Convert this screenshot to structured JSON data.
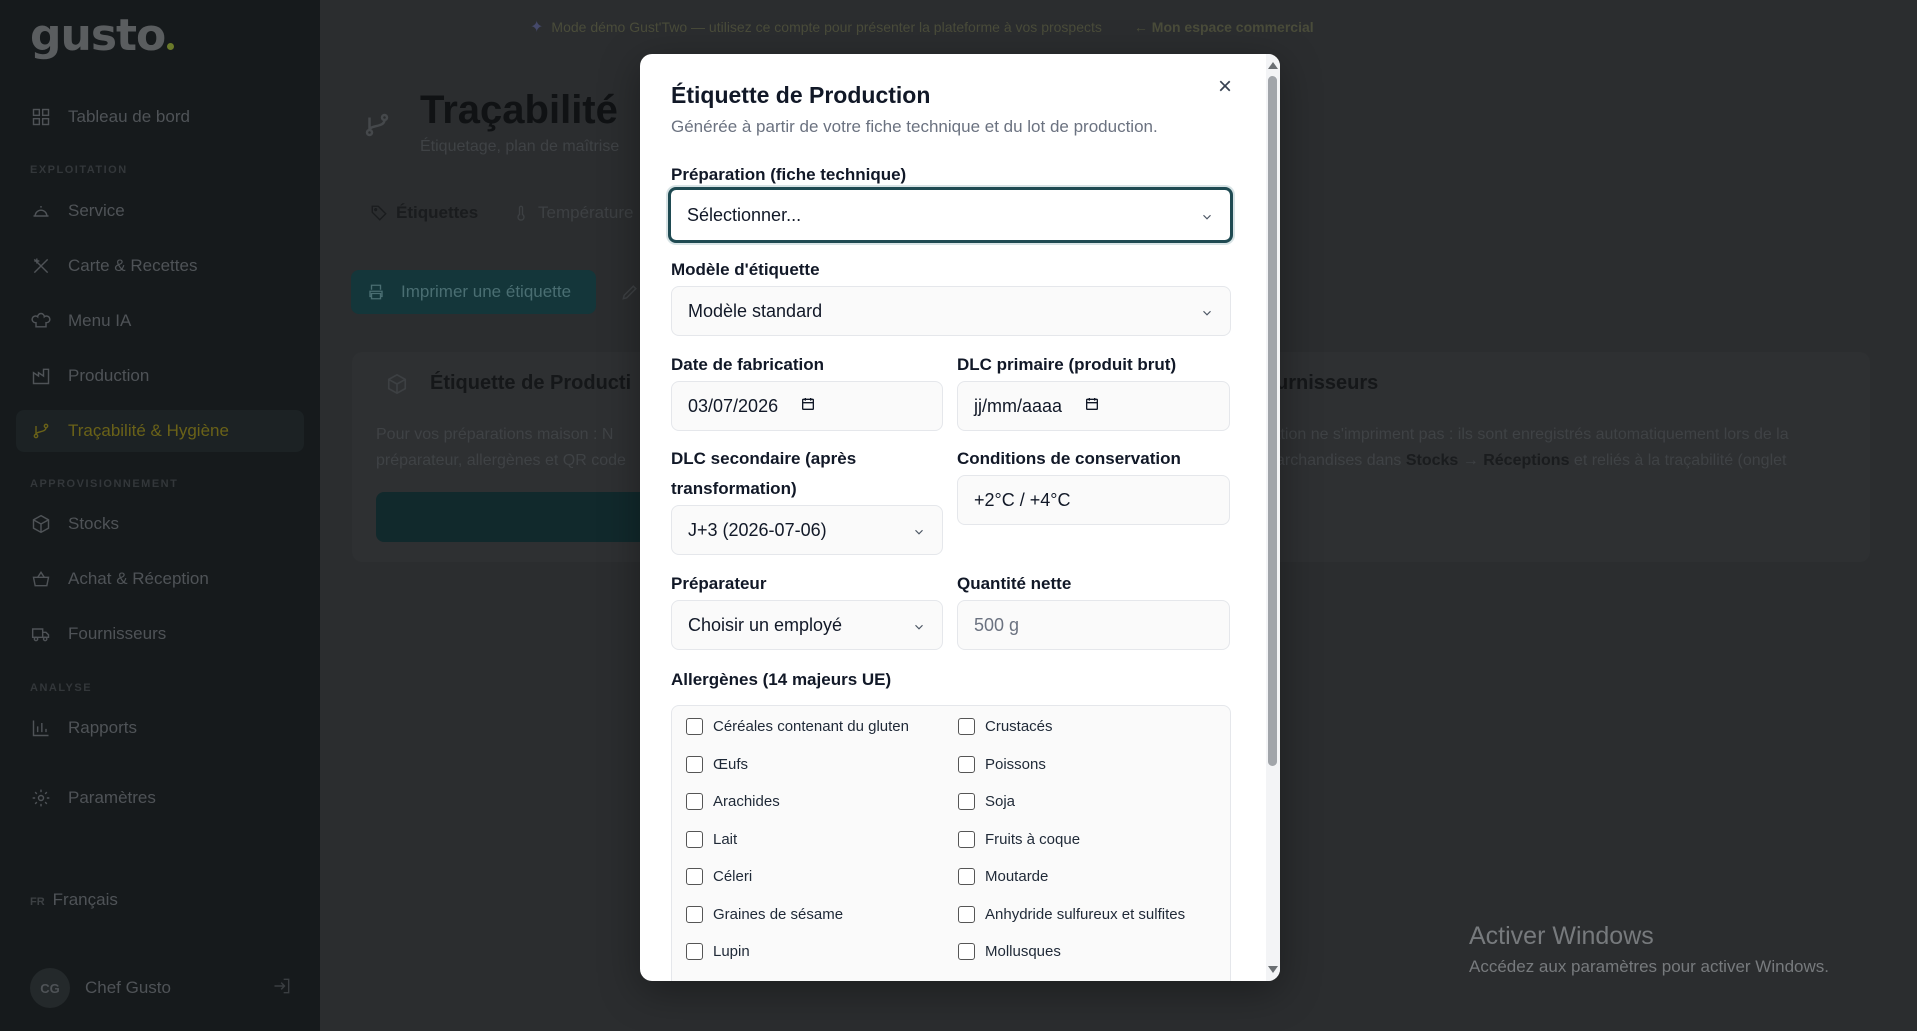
{
  "sidebar": {
    "logo": "gusto",
    "items": [
      {
        "label": "Tableau de bord",
        "icon": "dashboard-icon"
      },
      {
        "label": "Service",
        "icon": "service-icon"
      },
      {
        "label": "Carte & Recettes",
        "icon": "utensils-icon"
      },
      {
        "label": "Menu IA",
        "icon": "chef-hat-icon"
      },
      {
        "label": "Production",
        "icon": "factory-icon"
      },
      {
        "label": "Traçabilité & Hygiène",
        "icon": "branch-icon"
      },
      {
        "label": "Stocks",
        "icon": "box-icon"
      },
      {
        "label": "Achat & Réception",
        "icon": "basket-icon"
      },
      {
        "label": "Fournisseurs",
        "icon": "truck-icon"
      },
      {
        "label": "Rapports",
        "icon": "chart-icon"
      },
      {
        "label": "Paramètres",
        "icon": "gear-icon"
      }
    ],
    "sections": {
      "exploitation": "EXPLOITATION",
      "approvisionnement": "APPROVISIONNEMENT",
      "analyse": "ANALYSE"
    },
    "language": {
      "code": "FR",
      "label": "Français"
    },
    "user": {
      "initials": "CG",
      "name": "Chef Gusto"
    }
  },
  "topbar": {
    "demo_text": "Mode démo Gust'Two — utilisez ce compte pour présenter la plateforme à vos prospects",
    "back_text": "← Mon espace commercial"
  },
  "page": {
    "title": "Traçabilité",
    "subtitle": "Étiquetage, plan de maîtrise",
    "tabs": [
      {
        "label": "Étiquettes"
      },
      {
        "label": "Température"
      }
    ],
    "print_button": "Imprimer une étiquette",
    "card_left": {
      "title": "Étiquette de Producti",
      "text1": "Pour vos préparations maison : N",
      "text2": "préparateur, allergènes et QR code"
    },
    "card_right": {
      "title": "urnisseurs",
      "text1": "ttion ne s'impriment pas : ils sont enregistrés automatiquement lors de la",
      "text2_pre": "archandises dans ",
      "text2_b1": "Stocks",
      "text2_mid": " → ",
      "text2_b2": "Réceptions",
      "text2_post": " et reliés à la traçabilité (onglet"
    }
  },
  "modal": {
    "title": "Étiquette de Production",
    "subtitle": "Générée à partir de votre fiche technique et du lot de production.",
    "preparation": {
      "label": "Préparation (fiche technique)",
      "value": "Sélectionner..."
    },
    "template": {
      "label": "Modèle d'étiquette",
      "value": "Modèle standard"
    },
    "date_fab": {
      "label": "Date de fabrication",
      "value": "03/07/2026"
    },
    "dlc_primary": {
      "label": "DLC primaire (produit brut)",
      "value": "jj/mm/aaaa"
    },
    "dlc_secondary": {
      "label_line1": "DLC secondaire (après",
      "label_line2": "transformation)",
      "value": "J+3 (2026-07-06)"
    },
    "conservation": {
      "label": "Conditions de conservation",
      "value": "+2°C / +4°C"
    },
    "preparer": {
      "label": "Préparateur",
      "value": "Choisir un employé"
    },
    "quantity": {
      "label": "Quantité nette",
      "placeholder": "500 g"
    },
    "allergens_label": "Allergènes (14 majeurs UE)",
    "allergens": [
      "Céréales contenant du gluten",
      "Crustacés",
      "Œufs",
      "Poissons",
      "Arachides",
      "Soja",
      "Lait",
      "Fruits à coque",
      "Céleri",
      "Moutarde",
      "Graines de sésame",
      "Anhydride sulfureux et sulfites",
      "Lupin",
      "Mollusques"
    ]
  },
  "watermark": {
    "line1": "Activer Windows",
    "line2": "Accédez aux paramètres pour activer Windows."
  }
}
